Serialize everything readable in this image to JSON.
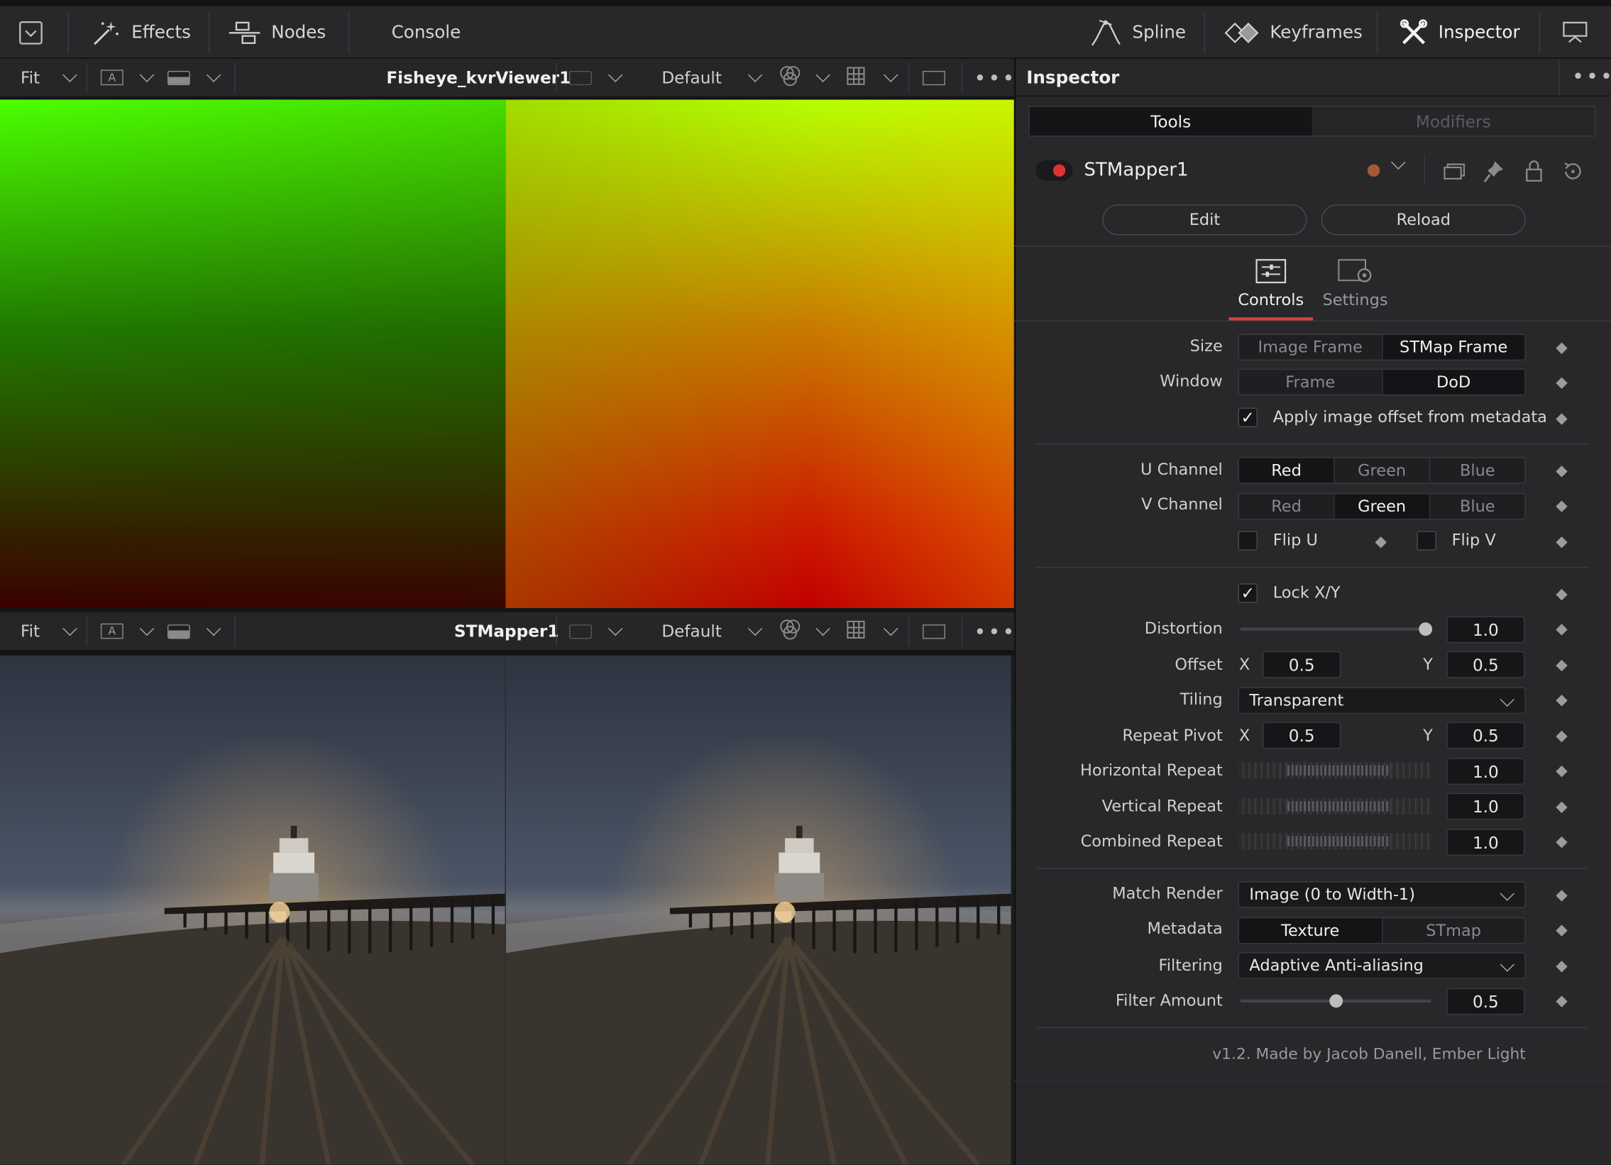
{
  "toolbar": {
    "effects_label": "Effects",
    "nodes_label": "Nodes",
    "console_label": "Console",
    "spline_label": "Spline",
    "keyframes_label": "Keyframes",
    "inspector_label": "Inspector"
  },
  "viewer_top": {
    "fit_label": "Fit",
    "channel_label": "A",
    "viewer_name": "Fisheye_kvrViewer1",
    "lut_label": "Default"
  },
  "viewer_bottom": {
    "fit_label": "Fit",
    "channel_label": "A",
    "viewer_name": "STMapper1",
    "lut_label": "Default"
  },
  "inspector": {
    "title": "Inspector",
    "tabs": {
      "tools": "Tools",
      "modifiers": "Modifiers"
    },
    "node_name": "STMapper1",
    "edit_label": "Edit",
    "reload_label": "Reload",
    "page_tabs": {
      "controls": "Controls",
      "settings": "Settings"
    },
    "controls": {
      "size_label": "Size",
      "size_options": [
        "Image Frame",
        "STMap Frame"
      ],
      "window_label": "Window",
      "window_options": [
        "Frame",
        "DoD"
      ],
      "apply_offset_label": "Apply image offset from metadata",
      "u_channel_label": "U Channel",
      "v_channel_label": "V Channel",
      "channel_options": [
        "Red",
        "Green",
        "Blue"
      ],
      "flip_u_label": "Flip U",
      "flip_v_label": "Flip V",
      "lock_xy_label": "Lock X/Y",
      "distortion_label": "Distortion",
      "distortion_value": "1.0",
      "offset_label": "Offset",
      "x_label": "X",
      "y_label": "Y",
      "offset_x": "0.5",
      "offset_y": "0.5",
      "tiling_label": "Tiling",
      "tiling_value": "Transparent",
      "repeat_pivot_label": "Repeat Pivot",
      "repeat_pivot_x": "0.5",
      "repeat_pivot_y": "0.5",
      "horizontal_repeat_label": "Horizontal Repeat",
      "horizontal_repeat_value": "1.0",
      "vertical_repeat_label": "Vertical Repeat",
      "vertical_repeat_value": "1.0",
      "combined_repeat_label": "Combined Repeat",
      "combined_repeat_value": "1.0",
      "match_render_label": "Match Render",
      "match_render_value": "Image (0 to Width-1)",
      "metadata_label": "Metadata",
      "metadata_options": [
        "Texture",
        "STmap"
      ],
      "filtering_label": "Filtering",
      "filtering_value": "Adaptive Anti-aliasing",
      "filter_amount_label": "Filter Amount",
      "filter_amount_value": "0.5",
      "distortion_level": 1.0,
      "filter_amount_level": 0.5
    },
    "footer": "v1.2. Made by Jacob Danell, Ember Light"
  },
  "colors": {
    "accent_red": "#e0322d",
    "tab_underline": "#d2453c"
  }
}
